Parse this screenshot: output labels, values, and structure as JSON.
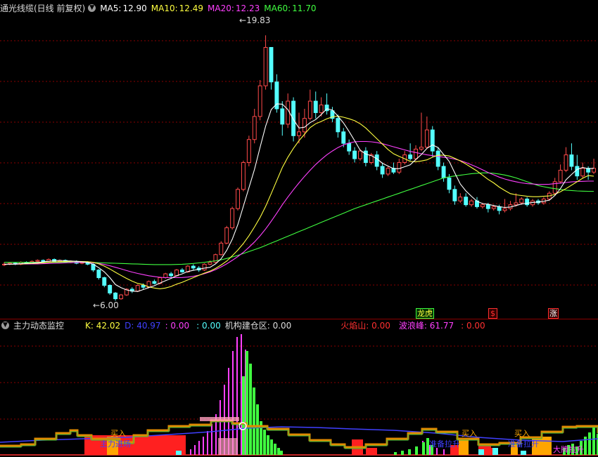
{
  "main_header": {
    "title": "通光线缆(日线 前复权)",
    "ma5_label": "MA5:",
    "ma5_value": "12.90",
    "ma10_label": "MA10:",
    "ma10_value": "12.49",
    "ma20_label": "MA20:",
    "ma20_value": "12.23",
    "ma60_label": "MA60:",
    "ma60_value": "11.70"
  },
  "price_annotations": {
    "high": "19.83",
    "low": "6.00"
  },
  "event_tags": [
    "龙虎",
    "$",
    "涨"
  ],
  "indicator_header": {
    "title": "主力动态监控",
    "k": "K: 42.02",
    "d": "D: 40.97",
    "v1": ": 0.00",
    "v2": ": 0.00",
    "jigou": "机构建仓区: 0.00",
    "huoyan": "火焰山: 0.00",
    "bolang": "波浪峰: 61.77",
    "v3": ": 0.00"
  },
  "indicator_labels": [
    "买入",
    "买入",
    "买入",
    "主力进场",
    "准备拉升",
    "准备拉升",
    "大牌拉升"
  ],
  "colors": {
    "up": "#ff4a4a",
    "down": "#54ffff",
    "ma5": "#ffffff",
    "ma10": "#ffff40",
    "ma20": "#ff40ff",
    "ma60": "#40ff40",
    "grid": "#8b0000"
  },
  "chart_data": {
    "type": "candlestick",
    "ylim": [
      5.5,
      20.5
    ],
    "candles": [
      [
        7.9,
        7.9,
        8.0,
        7.8
      ],
      [
        7.9,
        7.95,
        8.0,
        7.85
      ],
      [
        7.95,
        7.9,
        8.0,
        7.85
      ],
      [
        7.9,
        8.0,
        8.05,
        7.85
      ],
      [
        8.0,
        7.95,
        8.05,
        7.9
      ],
      [
        7.95,
        8.05,
        8.1,
        7.9
      ],
      [
        8.05,
        8.1,
        8.15,
        8.0
      ],
      [
        8.1,
        8.05,
        8.15,
        8.0
      ],
      [
        8.05,
        8.15,
        8.2,
        8.0
      ],
      [
        8.15,
        8.05,
        8.2,
        8.0
      ],
      [
        8.05,
        8.1,
        8.15,
        8.0
      ],
      [
        8.1,
        8.0,
        8.15,
        7.95
      ],
      [
        8.0,
        8.05,
        8.1,
        7.95
      ],
      [
        8.05,
        7.95,
        8.1,
        7.9
      ],
      [
        7.95,
        8.0,
        8.05,
        7.9
      ],
      [
        8.0,
        7.9,
        8.05,
        7.85
      ],
      [
        7.9,
        7.6,
        7.95,
        7.5
      ],
      [
        7.6,
        7.2,
        7.65,
        7.1
      ],
      [
        7.2,
        6.8,
        7.25,
        6.7
      ],
      [
        6.8,
        6.4,
        6.85,
        6.3
      ],
      [
        6.4,
        6.1,
        6.45,
        6.0
      ],
      [
        6.1,
        6.3,
        6.35,
        6.05
      ],
      [
        6.3,
        6.6,
        6.65,
        6.25
      ],
      [
        6.6,
        6.5,
        6.7,
        6.4
      ],
      [
        6.5,
        6.8,
        6.85,
        6.45
      ],
      [
        6.8,
        6.7,
        6.9,
        6.6
      ],
      [
        6.7,
        7.0,
        7.05,
        6.65
      ],
      [
        7.0,
        6.9,
        7.1,
        6.85
      ],
      [
        6.9,
        7.2,
        7.25,
        6.85
      ],
      [
        7.2,
        7.4,
        7.45,
        7.15
      ],
      [
        7.4,
        7.3,
        7.5,
        7.2
      ],
      [
        7.3,
        7.6,
        7.65,
        7.25
      ],
      [
        7.6,
        7.5,
        7.7,
        7.45
      ],
      [
        7.5,
        7.8,
        7.85,
        7.45
      ],
      [
        7.8,
        7.7,
        7.9,
        7.6
      ],
      [
        7.7,
        7.6,
        7.8,
        7.5
      ],
      [
        7.6,
        7.9,
        7.95,
        7.55
      ],
      [
        7.9,
        8.0,
        8.1,
        7.85
      ],
      [
        8.0,
        8.4,
        8.45,
        7.95
      ],
      [
        8.4,
        9.0,
        9.1,
        8.35
      ],
      [
        9.0,
        9.8,
        9.9,
        8.95
      ],
      [
        9.8,
        10.8,
        10.9,
        9.7
      ],
      [
        10.8,
        11.8,
        11.9,
        10.7
      ],
      [
        11.8,
        13.2,
        13.3,
        11.7
      ],
      [
        13.2,
        14.4,
        14.6,
        13.0
      ],
      [
        14.4,
        15.6,
        16.0,
        14.2
      ],
      [
        15.6,
        17.2,
        17.5,
        15.4
      ],
      [
        17.2,
        19.2,
        19.83,
        17.0
      ],
      [
        19.2,
        17.4,
        19.0,
        17.0
      ],
      [
        17.4,
        16.0,
        17.8,
        15.8
      ],
      [
        16.0,
        15.2,
        16.4,
        14.6
      ],
      [
        15.2,
        16.4,
        16.8,
        15.0
      ],
      [
        16.4,
        14.6,
        16.6,
        14.3
      ],
      [
        14.6,
        14.8,
        15.8,
        14.2
      ],
      [
        14.8,
        15.5,
        16.0,
        14.5
      ],
      [
        15.5,
        16.4,
        17.0,
        15.4
      ],
      [
        16.4,
        15.8,
        16.9,
        15.5
      ],
      [
        15.8,
        16.2,
        16.6,
        15.6
      ],
      [
        16.2,
        15.9,
        16.8,
        15.7
      ],
      [
        15.9,
        15.5,
        16.1,
        15.3
      ],
      [
        15.5,
        14.8,
        15.7,
        14.5
      ],
      [
        14.8,
        14.2,
        15.0,
        14.0
      ],
      [
        14.2,
        13.8,
        14.4,
        13.6
      ],
      [
        13.8,
        13.4,
        14.0,
        13.2
      ],
      [
        13.4,
        13.8,
        13.9,
        13.3
      ],
      [
        13.8,
        13.2,
        14.0,
        13.0
      ],
      [
        13.2,
        13.6,
        13.7,
        13.1
      ],
      [
        13.6,
        13.0,
        13.8,
        12.8
      ],
      [
        13.0,
        12.6,
        13.2,
        12.4
      ],
      [
        12.6,
        12.9,
        13.0,
        12.5
      ],
      [
        12.9,
        12.7,
        13.2,
        12.6
      ],
      [
        12.7,
        13.2,
        13.4,
        12.6
      ],
      [
        13.2,
        13.6,
        13.8,
        13.1
      ],
      [
        13.6,
        13.4,
        14.2,
        13.3
      ],
      [
        13.4,
        13.9,
        14.1,
        13.3
      ],
      [
        13.9,
        14.0,
        15.8,
        13.8
      ],
      [
        14.0,
        14.9,
        15.6,
        13.9
      ],
      [
        14.9,
        13.8,
        15.1,
        13.5
      ],
      [
        13.8,
        13.0,
        14.0,
        12.8
      ],
      [
        13.0,
        12.4,
        13.2,
        12.2
      ],
      [
        12.4,
        11.8,
        12.6,
        11.6
      ],
      [
        11.8,
        11.2,
        12.0,
        11.0
      ],
      [
        11.2,
        11.4,
        11.6,
        11.1
      ],
      [
        11.4,
        11.0,
        11.6,
        10.9
      ],
      [
        11.0,
        11.2,
        11.3,
        10.9
      ],
      [
        11.2,
        10.9,
        11.4,
        10.8
      ],
      [
        10.9,
        11.0,
        11.1,
        10.8
      ],
      [
        11.0,
        10.8,
        11.1,
        10.6
      ],
      [
        10.8,
        10.9,
        11.0,
        10.7
      ],
      [
        10.9,
        10.7,
        11.0,
        10.5
      ],
      [
        10.7,
        10.8,
        11.3,
        10.6
      ],
      [
        10.8,
        11.0,
        11.2,
        10.7
      ],
      [
        11.0,
        11.1,
        11.6,
        10.9
      ],
      [
        11.1,
        11.3,
        11.4,
        11.0
      ],
      [
        11.3,
        11.0,
        11.4,
        10.9
      ],
      [
        11.0,
        11.2,
        11.3,
        10.9
      ],
      [
        11.2,
        11.1,
        11.3,
        11.0
      ],
      [
        11.1,
        11.3,
        11.4,
        11.0
      ],
      [
        11.3,
        11.6,
        11.7,
        11.2
      ],
      [
        11.6,
        12.2,
        12.4,
        11.5
      ],
      [
        12.2,
        12.8,
        13.1,
        12.1
      ],
      [
        12.8,
        13.6,
        14.0,
        12.7
      ],
      [
        13.6,
        13.0,
        14.2,
        12.8
      ],
      [
        13.0,
        12.5,
        13.6,
        12.3
      ],
      [
        12.5,
        12.9,
        13.2,
        12.4
      ],
      [
        12.9,
        12.7,
        13.0,
        12.3
      ],
      [
        12.7,
        12.9,
        13.4,
        12.6
      ]
    ],
    "ma5": [
      7.9,
      7.9,
      7.92,
      7.93,
      7.95,
      7.96,
      7.98,
      8.02,
      8.06,
      8.08,
      8.1,
      8.08,
      8.07,
      8.05,
      8.02,
      8.0,
      7.9,
      7.72,
      7.5,
      7.2,
      6.84,
      6.68,
      6.56,
      6.5,
      6.48,
      6.58,
      6.68,
      6.78,
      6.92,
      7.04,
      7.16,
      7.3,
      7.4,
      7.52,
      7.58,
      7.64,
      7.7,
      7.74,
      7.92,
      8.18,
      8.62,
      9.2,
      9.96,
      10.92,
      11.88,
      12.84,
      14.0,
      15.1,
      15.96,
      16.26,
      16.24,
      15.96,
      15.44,
      15.0,
      15.04,
      15.28,
      15.44,
      15.7,
      16.0,
      15.94,
      15.62,
      15.26,
      14.82,
      14.34,
      13.84,
      13.64,
      13.56,
      13.4,
      13.16,
      13.02,
      12.88,
      12.88,
      12.98,
      13.08,
      13.36,
      13.62,
      13.94,
      14.12,
      13.98,
      13.62,
      13.26,
      12.66,
      12.08,
      11.72,
      11.44,
      11.18,
      11.06,
      11.02,
      10.96,
      10.9,
      10.86,
      10.88,
      10.96,
      11.04,
      11.08,
      11.12,
      11.14,
      11.18,
      11.24,
      11.48,
      11.84,
      12.3,
      12.58,
      12.84,
      12.94,
      12.88,
      12.9
    ],
    "ma10": [
      7.9,
      7.9,
      7.91,
      7.92,
      7.93,
      7.94,
      7.95,
      7.97,
      8.0,
      8.02,
      8.03,
      8.04,
      8.05,
      8.05,
      8.04,
      8.03,
      8.0,
      7.92,
      7.8,
      7.65,
      7.48,
      7.32,
      7.16,
      7.02,
      6.9,
      6.84,
      6.72,
      6.66,
      6.62,
      6.66,
      6.74,
      6.86,
      6.96,
      7.08,
      7.2,
      7.32,
      7.44,
      7.54,
      7.68,
      7.86,
      8.06,
      8.34,
      8.64,
      8.98,
      9.38,
      9.84,
      10.34,
      10.92,
      11.58,
      12.26,
      12.94,
      13.48,
      13.94,
      14.34,
      14.68,
      15.02,
      15.22,
      15.34,
      15.48,
      15.58,
      15.62,
      15.56,
      15.48,
      15.38,
      15.22,
      15.0,
      14.72,
      14.44,
      14.16,
      13.88,
      13.66,
      13.52,
      13.4,
      13.26,
      13.24,
      13.28,
      13.34,
      13.48,
      13.58,
      13.58,
      13.54,
      13.42,
      13.28,
      13.12,
      12.94,
      12.76,
      12.54,
      12.32,
      12.14,
      11.92,
      11.74,
      11.58,
      11.52,
      11.48,
      11.44,
      11.42,
      11.42,
      11.44,
      11.46,
      11.54,
      11.68,
      11.84,
      12.02,
      12.2,
      12.38,
      12.52,
      12.49
    ],
    "ma20": [
      7.9,
      7.9,
      7.9,
      7.91,
      7.91,
      7.92,
      7.92,
      7.93,
      7.94,
      7.95,
      7.96,
      7.97,
      7.98,
      7.99,
      8.0,
      8.0,
      7.98,
      7.94,
      7.89,
      7.82,
      7.74,
      7.66,
      7.57,
      7.49,
      7.42,
      7.36,
      7.3,
      7.26,
      7.22,
      7.2,
      7.2,
      7.2,
      7.21,
      7.23,
      7.27,
      7.33,
      7.41,
      7.5,
      7.62,
      7.76,
      7.92,
      8.1,
      8.3,
      8.52,
      8.78,
      9.06,
      9.38,
      9.74,
      10.14,
      10.56,
      11.0,
      11.4,
      11.78,
      12.14,
      12.48,
      12.8,
      13.1,
      13.36,
      13.6,
      13.8,
      13.98,
      14.12,
      14.22,
      14.28,
      14.3,
      14.3,
      14.28,
      14.24,
      14.18,
      14.1,
      14.02,
      13.94,
      13.86,
      13.78,
      13.72,
      13.66,
      13.6,
      13.56,
      13.52,
      13.48,
      13.44,
      13.38,
      13.3,
      13.2,
      13.08,
      12.96,
      12.82,
      12.68,
      12.56,
      12.44,
      12.34,
      12.26,
      12.2,
      12.14,
      12.1,
      12.08,
      12.06,
      12.06,
      12.07,
      12.1,
      12.13,
      12.16,
      12.19,
      12.21,
      12.22,
      12.23,
      12.23
    ],
    "ma60": [
      8.0,
      8.0,
      8.0,
      8.0,
      8.0,
      8.0,
      8.0,
      8.0,
      8.0,
      8.0,
      8.0,
      8.0,
      8.0,
      8.0,
      8.0,
      8.0,
      7.99,
      7.98,
      7.97,
      7.96,
      7.95,
      7.94,
      7.93,
      7.92,
      7.91,
      7.9,
      7.89,
      7.88,
      7.88,
      7.88,
      7.88,
      7.89,
      7.9,
      7.92,
      7.94,
      7.97,
      8.0,
      8.04,
      8.08,
      8.13,
      8.2,
      8.28,
      8.36,
      8.46,
      8.56,
      8.66,
      8.76,
      8.88,
      9.0,
      9.12,
      9.24,
      9.36,
      9.48,
      9.6,
      9.72,
      9.84,
      9.96,
      10.08,
      10.2,
      10.32,
      10.44,
      10.56,
      10.68,
      10.8,
      10.9,
      11.0,
      11.1,
      11.2,
      11.3,
      11.4,
      11.5,
      11.6,
      11.7,
      11.8,
      11.9,
      12.0,
      12.1,
      12.2,
      12.3,
      12.4,
      12.46,
      12.5,
      12.54,
      12.58,
      12.62,
      12.64,
      12.66,
      12.66,
      12.64,
      12.6,
      12.55,
      12.48,
      12.4,
      12.3,
      12.2,
      12.1,
      12.0,
      11.94,
      11.88,
      11.84,
      11.8,
      11.76,
      11.74,
      11.72,
      11.71,
      11.7,
      11.7
    ]
  }
}
